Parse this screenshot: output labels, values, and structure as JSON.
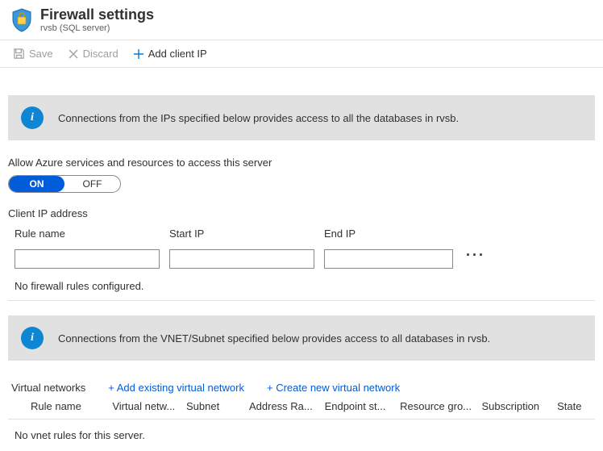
{
  "header": {
    "title": "Firewall settings",
    "subtitle": "rvsb (SQL server)"
  },
  "toolbar": {
    "save_label": "Save",
    "discard_label": "Discard",
    "add_client_ip_label": "Add client IP"
  },
  "banner_ip": "Connections from the IPs specified below provides access to all the databases in rvsb.",
  "allow_azure": {
    "label": "Allow Azure services and resources to access this server",
    "on_label": "ON",
    "off_label": "OFF"
  },
  "client_ip": {
    "section_label": "Client IP address",
    "rule_name_label": "Rule name",
    "start_ip_label": "Start IP",
    "end_ip_label": "End IP",
    "rule_name_value": "",
    "start_ip_value": "",
    "end_ip_value": "",
    "empty_message": "No firewall rules configured."
  },
  "banner_vnet": "Connections from the VNET/Subnet specified below provides access to all databases in rvsb.",
  "vnet": {
    "label": "Virtual networks",
    "add_existing_label": "+ Add existing virtual network",
    "create_new_label": "+ Create new virtual network",
    "columns": {
      "rule": "Rule name",
      "vn": "Virtual netw...",
      "subnet": "Subnet",
      "addr": "Address Ra...",
      "endpoint": "Endpoint st...",
      "rg": "Resource gro...",
      "sub": "Subscription",
      "state": "State"
    },
    "empty_message": "No vnet rules for this server."
  }
}
